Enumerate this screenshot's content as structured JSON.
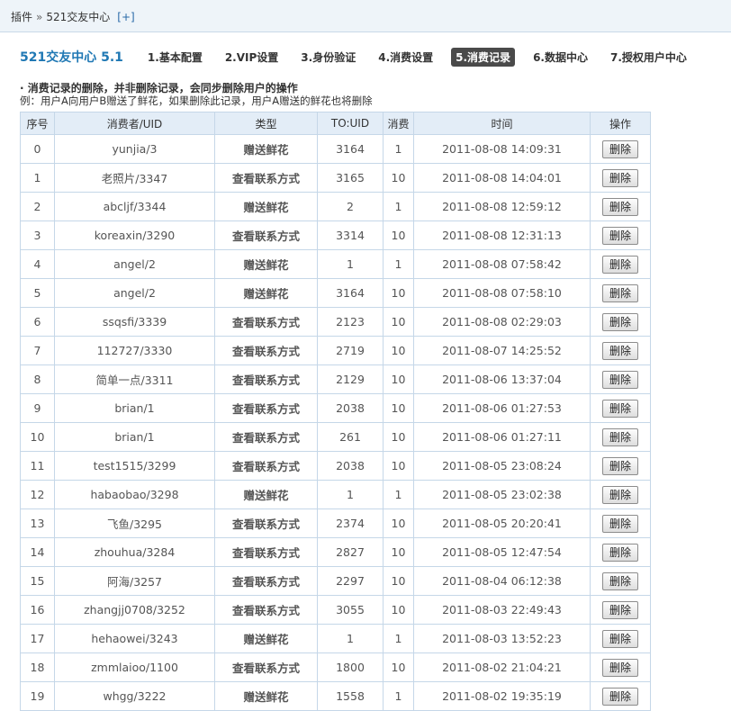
{
  "breadcrumb": {
    "root": "插件",
    "separator": "»",
    "current": "521交友中心",
    "add": "[+]"
  },
  "app_title": "521交友中心 5.1",
  "tabs": [
    {
      "label": "1.基本配置",
      "active": false
    },
    {
      "label": "2.VIP设置",
      "active": false
    },
    {
      "label": "3.身份验证",
      "active": false
    },
    {
      "label": "4.消费设置",
      "active": false
    },
    {
      "label": "5.消费记录",
      "active": true
    },
    {
      "label": "6.数据中心",
      "active": false
    },
    {
      "label": "7.授权用户中心",
      "active": false
    }
  ],
  "notes": {
    "line1": "· 消费记录的删除，并非删除记录，会同步删除用户的操作",
    "line2": "例：用户A向用户B赠送了鲜花，如果删除此记录，用户A赠送的鲜花也将删除"
  },
  "table": {
    "columns": [
      "序号",
      "消费者/UID",
      "类型",
      "TO:UID",
      "消费",
      "时间",
      "操作"
    ],
    "delete_label": "删除",
    "rows": [
      {
        "idx": "0",
        "user": "yunjia/3",
        "type": "赠送鲜花",
        "kind": "gift",
        "to": "3164",
        "cost": "1",
        "time": "2011-08-08 14:09:31"
      },
      {
        "idx": "1",
        "user": "老照片/3347",
        "type": "查看联系方式",
        "kind": "contact",
        "to": "3165",
        "cost": "10",
        "time": "2011-08-08 14:04:01"
      },
      {
        "idx": "2",
        "user": "abcljf/3344",
        "type": "赠送鲜花",
        "kind": "gift",
        "to": "2",
        "cost": "1",
        "time": "2011-08-08 12:59:12"
      },
      {
        "idx": "3",
        "user": "koreaxin/3290",
        "type": "查看联系方式",
        "kind": "contact",
        "to": "3314",
        "cost": "10",
        "time": "2011-08-08 12:31:13"
      },
      {
        "idx": "4",
        "user": "angel/2",
        "type": "赠送鲜花",
        "kind": "gift",
        "to": "1",
        "cost": "1",
        "time": "2011-08-08 07:58:42"
      },
      {
        "idx": "5",
        "user": "angel/2",
        "type": "赠送鲜花",
        "kind": "gift",
        "to": "3164",
        "cost": "10",
        "time": "2011-08-08 07:58:10"
      },
      {
        "idx": "6",
        "user": "ssqsfi/3339",
        "type": "查看联系方式",
        "kind": "contact",
        "to": "2123",
        "cost": "10",
        "time": "2011-08-08 02:29:03"
      },
      {
        "idx": "7",
        "user": "112727/3330",
        "type": "查看联系方式",
        "kind": "contact",
        "to": "2719",
        "cost": "10",
        "time": "2011-08-07 14:25:52"
      },
      {
        "idx": "8",
        "user": "简单一点/3311",
        "type": "查看联系方式",
        "kind": "contact",
        "to": "2129",
        "cost": "10",
        "time": "2011-08-06 13:37:04"
      },
      {
        "idx": "9",
        "user": "brian/1",
        "type": "查看联系方式",
        "kind": "contact",
        "to": "2038",
        "cost": "10",
        "time": "2011-08-06 01:27:53"
      },
      {
        "idx": "10",
        "user": "brian/1",
        "type": "查看联系方式",
        "kind": "contact",
        "to": "261",
        "cost": "10",
        "time": "2011-08-06 01:27:11"
      },
      {
        "idx": "11",
        "user": "test1515/3299",
        "type": "查看联系方式",
        "kind": "contact",
        "to": "2038",
        "cost": "10",
        "time": "2011-08-05 23:08:24"
      },
      {
        "idx": "12",
        "user": "habaobao/3298",
        "type": "赠送鲜花",
        "kind": "gift",
        "to": "1",
        "cost": "1",
        "time": "2011-08-05 23:02:38"
      },
      {
        "idx": "13",
        "user": "飞鱼/3295",
        "type": "查看联系方式",
        "kind": "contact",
        "to": "2374",
        "cost": "10",
        "time": "2011-08-05 20:20:41"
      },
      {
        "idx": "14",
        "user": "zhouhua/3284",
        "type": "查看联系方式",
        "kind": "contact",
        "to": "2827",
        "cost": "10",
        "time": "2011-08-05 12:47:54"
      },
      {
        "idx": "15",
        "user": "阿海/3257",
        "type": "查看联系方式",
        "kind": "contact",
        "to": "2297",
        "cost": "10",
        "time": "2011-08-04 06:12:38"
      },
      {
        "idx": "16",
        "user": "zhangjj0708/3252",
        "type": "查看联系方式",
        "kind": "contact",
        "to": "3055",
        "cost": "10",
        "time": "2011-08-03 22:49:43"
      },
      {
        "idx": "17",
        "user": "hehaowei/3243",
        "type": "赠送鲜花",
        "kind": "gift",
        "to": "1",
        "cost": "1",
        "time": "2011-08-03 13:52:23"
      },
      {
        "idx": "18",
        "user": "zmmlaioo/1100",
        "type": "查看联系方式",
        "kind": "contact",
        "to": "1800",
        "cost": "10",
        "time": "2011-08-02 21:04:21"
      },
      {
        "idx": "19",
        "user": "whgg/3222",
        "type": "赠送鲜花",
        "kind": "gift",
        "to": "1558",
        "cost": "1",
        "time": "2011-08-02 19:35:19"
      }
    ]
  }
}
